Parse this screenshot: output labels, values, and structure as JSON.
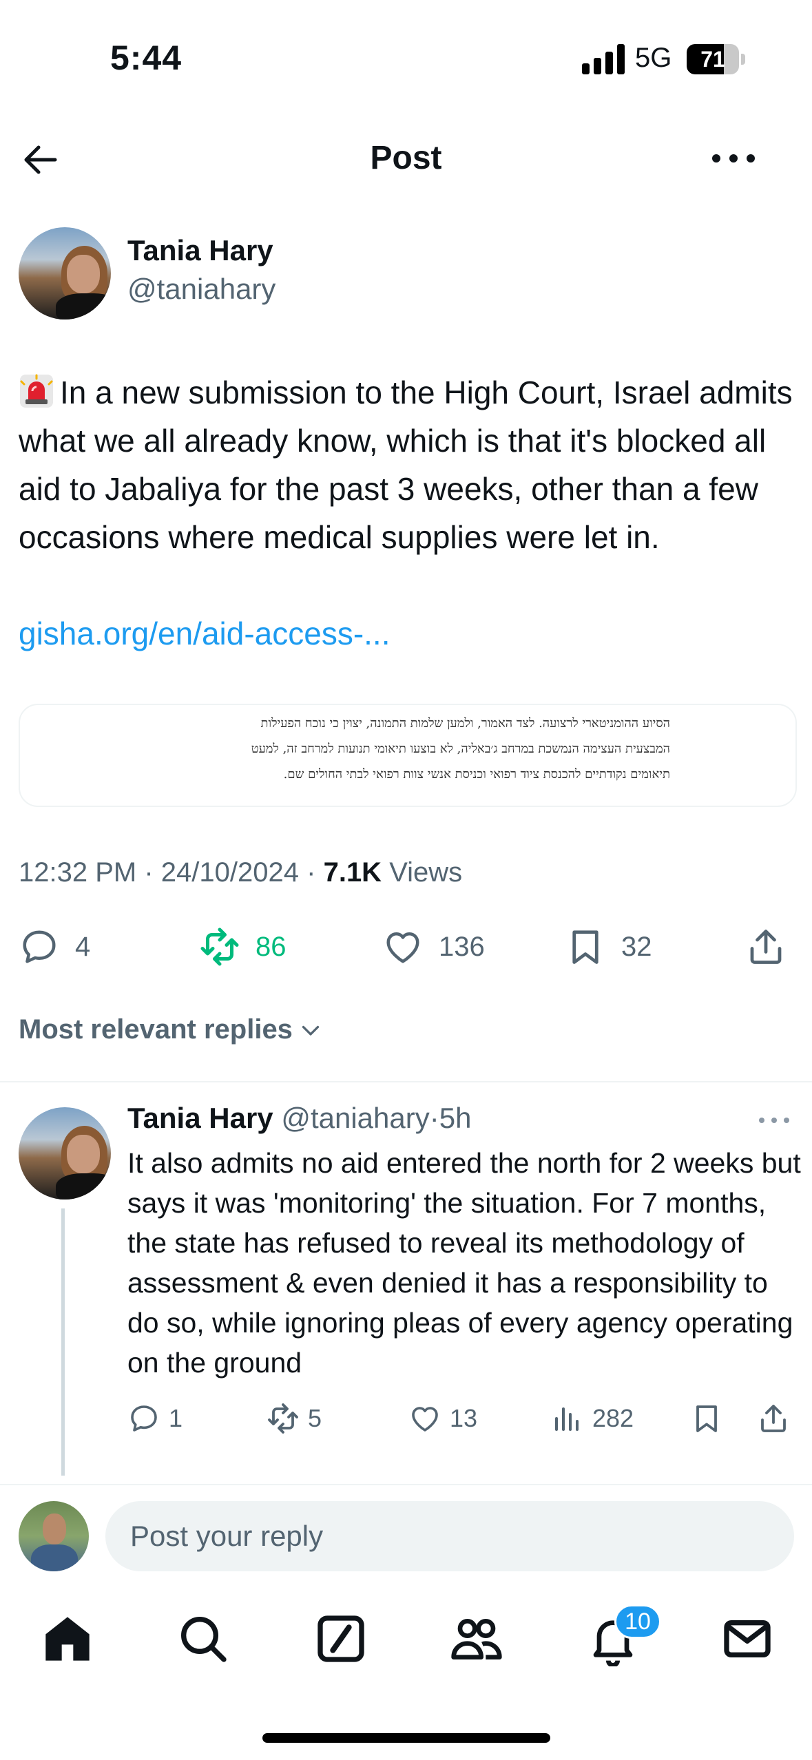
{
  "status_bar": {
    "time": "5:44",
    "network": "5G",
    "battery": "71",
    "battery_level": 0.71
  },
  "header": {
    "title": "Post",
    "back_icon": "arrow-left-icon",
    "more_icon": "more-horizontal-icon"
  },
  "post": {
    "author_name": "Tania Hary",
    "author_handle": "@taniahary",
    "emoji": "siren-icon",
    "text": "In a new submission to the High Court, Israel admits what we all already know, which is that it's blocked all aid to Jabaliya for the past 3 weeks, other than a few occasions where medical supplies were let in.",
    "link": "gisha.org/en/aid-access-...",
    "media_text": [
      "הסיוע ההומניטארי לרצועה. לצד האמור, ולמען שלמות התמונה, יצוין כי נוכח הפעילות",
      "המבצעית העצימה הנמשכת במרחב ג׳באליה, לא בוצעו תיאומי תנועות למרחב זה, למעט",
      "תיאומים נקודתיים להכנסת ציוד רפואי וכניסת אנשי צוות רפואי לבתי החולים שם."
    ],
    "time": "12:32 PM",
    "date": "24/10/2024",
    "views": "7.1K",
    "views_label": "Views",
    "separator": "·",
    "replies": "4",
    "reposts": "86",
    "likes": "136",
    "bookmarks": "32"
  },
  "replies_section": {
    "sort_label": "Most relevant replies"
  },
  "reply": {
    "author_name": "Tania Hary",
    "author_handle": "@taniahary",
    "age": "5h",
    "separator": "·",
    "text": "It also admits no aid entered the north for 2 weeks but says it was 'monitoring' the situation. For 7 months, the state has refused to reveal its methodology of assessment & even denied it has a responsibility to do so, while ignoring pleas of every agency operating on the ground",
    "replies": "1",
    "reposts": "5",
    "likes": "13",
    "views": "282"
  },
  "compose": {
    "placeholder": "Post your reply"
  },
  "tabbar": {
    "notifications_badge": "10"
  },
  "colors": {
    "accent": "#1d9bf0",
    "repost_active": "#00ba7c",
    "text_primary": "#0f1419",
    "text_secondary": "#536471"
  }
}
